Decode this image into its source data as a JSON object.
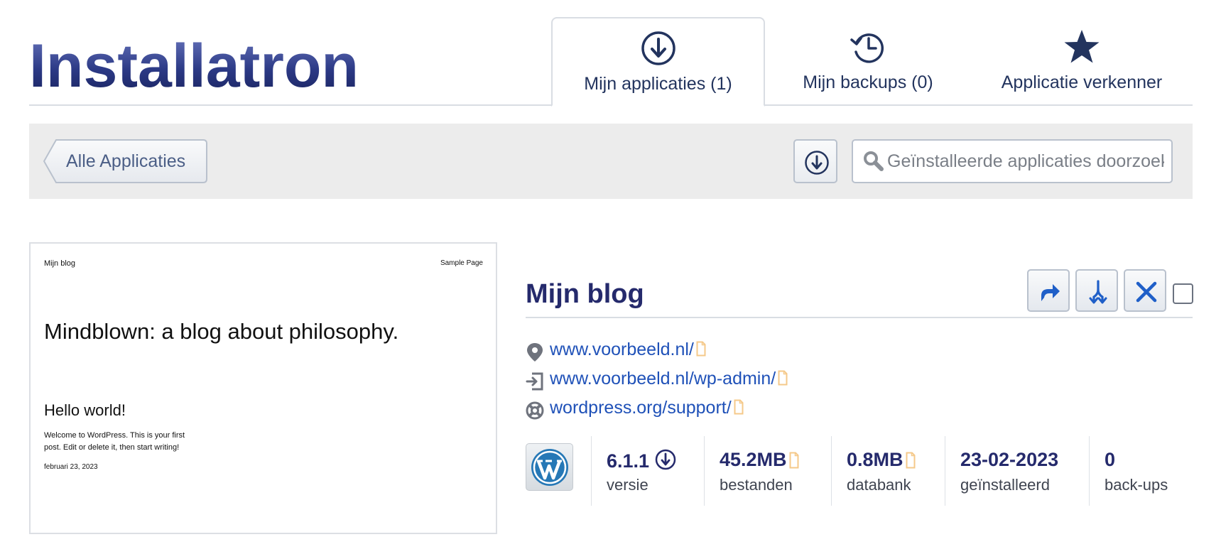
{
  "brand": {
    "logo_text": "Installatron"
  },
  "tabs": [
    {
      "label": "Mijn applicaties (1)",
      "icon": "download-circle-icon",
      "active": true
    },
    {
      "label": "Mijn backups (0)",
      "icon": "history-icon",
      "active": false
    },
    {
      "label": "Applicatie verkenner",
      "icon": "star-icon",
      "active": false
    }
  ],
  "toolbar": {
    "back_label": "Alle Applicaties",
    "download_icon": "download-circle-icon",
    "search_placeholder": "Geïnstalleerde applicaties doorzoeken"
  },
  "preview": {
    "site_title": "Mijn blog",
    "nav_item": "Sample Page",
    "tagline": "Mindblown: a blog about philosophy.",
    "post_title": "Hello world!",
    "post_excerpt": "Welcome to WordPress. This is your first post. Edit or delete it, then start writing!",
    "post_date": "februari 23, 2023"
  },
  "app": {
    "title": "Mijn blog",
    "actions": [
      {
        "name": "edit",
        "icon": "share-arrow-icon"
      },
      {
        "name": "clone",
        "icon": "merge-arrows-icon"
      },
      {
        "name": "delete",
        "icon": "close-icon"
      }
    ],
    "links": [
      {
        "icon": "location-pin-icon",
        "text": "www.voorbeeld.nl/"
      },
      {
        "icon": "login-icon",
        "text": "www.voorbeeld.nl/wp-admin/"
      },
      {
        "icon": "lifebuoy-icon",
        "text": "wordpress.org/support/"
      }
    ],
    "stats": {
      "version": {
        "value": "6.1.1",
        "label": "versie"
      },
      "files": {
        "value": "45.2MB",
        "label": "bestanden"
      },
      "database": {
        "value": "0.8MB",
        "label": "databank"
      },
      "installed": {
        "value": "23-02-2023",
        "label": "geïnstalleerd"
      },
      "backups": {
        "value": "0",
        "label": "back-ups"
      }
    }
  },
  "colors": {
    "brand_navy": "#252a6c",
    "link_blue": "#1f51b8",
    "toolbar_bg": "#ececec",
    "copy_icon": "#f5c98a",
    "action_blue": "#1f5fc8"
  }
}
